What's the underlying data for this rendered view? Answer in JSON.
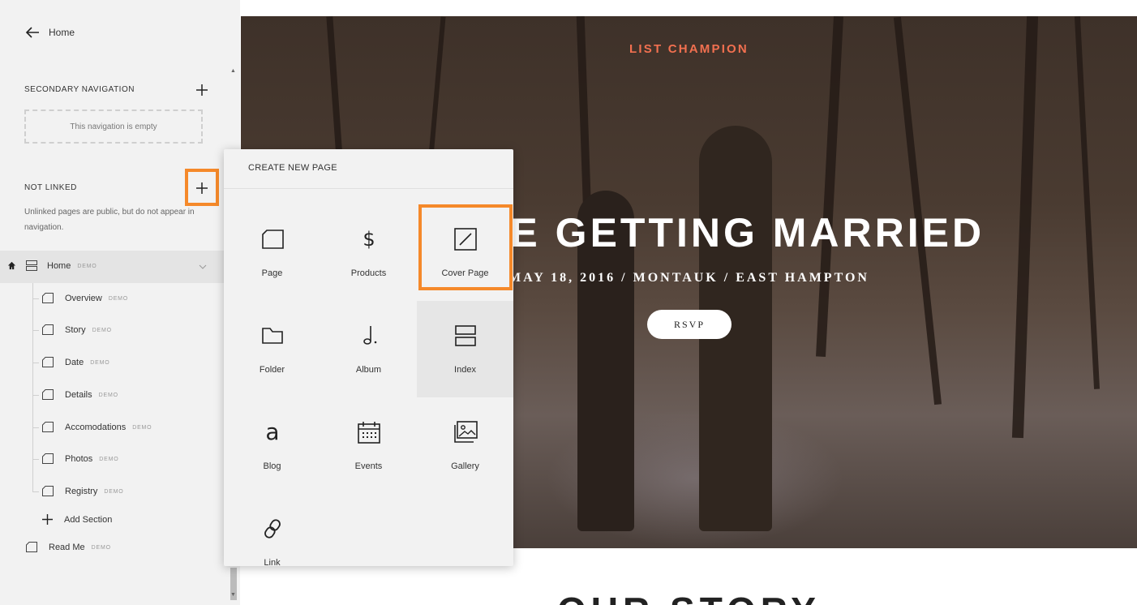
{
  "sidebar": {
    "back_label": "Home",
    "secondary_navigation": {
      "title": "SECONDARY NAVIGATION",
      "empty_text": "This navigation is empty"
    },
    "not_linked": {
      "title": "NOT LINKED",
      "hint": "Unlinked pages are public, but do not appear in navigation."
    },
    "home": {
      "label": "Home",
      "badge": "DEMO"
    },
    "pages": [
      {
        "label": "Overview",
        "badge": "DEMO"
      },
      {
        "label": "Story",
        "badge": "DEMO"
      },
      {
        "label": "Date",
        "badge": "DEMO"
      },
      {
        "label": "Details",
        "badge": "DEMO"
      },
      {
        "label": "Accomodations",
        "badge": "DEMO"
      },
      {
        "label": "Photos",
        "badge": "DEMO"
      },
      {
        "label": "Registry",
        "badge": "DEMO"
      }
    ],
    "add_section_label": "Add Section",
    "read_me": {
      "label": "Read Me",
      "badge": "DEMO"
    }
  },
  "popup": {
    "title": "CREATE NEW PAGE",
    "items": [
      {
        "label": "Page",
        "icon": "page-icon"
      },
      {
        "label": "Products",
        "icon": "dollar-icon"
      },
      {
        "label": "Cover Page",
        "icon": "cover-page-icon"
      },
      {
        "label": "Folder",
        "icon": "folder-icon"
      },
      {
        "label": "Album",
        "icon": "music-note-icon"
      },
      {
        "label": "Index",
        "icon": "index-icon"
      },
      {
        "label": "Blog",
        "icon": "blog-icon"
      },
      {
        "label": "Events",
        "icon": "calendar-icon"
      },
      {
        "label": "Gallery",
        "icon": "gallery-icon"
      },
      {
        "label": "Link",
        "icon": "link-icon"
      }
    ]
  },
  "preview": {
    "site_title": "LIST CHAMPION",
    "headline": "WE'RE GETTING MARRIED",
    "subline": "MAY 18, 2016 / MONTAUK / EAST HAMPTON",
    "rsvp_label": "RSVP",
    "next_section_title": "OUR STORY"
  },
  "colors": {
    "highlight": "#f5892a",
    "site_title": "#f27050",
    "sidebar_bg": "#f2f2f2"
  }
}
